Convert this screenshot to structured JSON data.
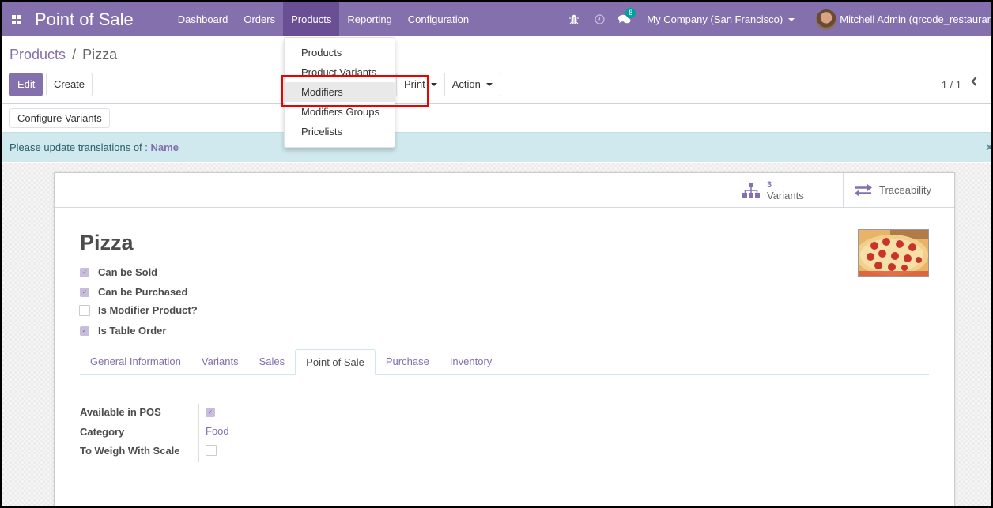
{
  "navbar": {
    "app_title": "Point of Sale",
    "menu": [
      {
        "label": "Dashboard",
        "active": false
      },
      {
        "label": "Orders",
        "active": false
      },
      {
        "label": "Products",
        "active": true
      },
      {
        "label": "Reporting",
        "active": false
      },
      {
        "label": "Configuration",
        "active": false
      }
    ],
    "systray": {
      "debug_icon": "bug-icon",
      "activity_icon": "clock-icon",
      "messages_icon": "chat-icon",
      "messages_count": "8",
      "company": "My Company (San Francisco)",
      "user": "Mitchell Admin (qrcode_restaurar"
    },
    "color": "#8470ad",
    "active_color": "#6b4f95"
  },
  "products_menu": {
    "items": [
      {
        "label": "Products"
      },
      {
        "label": "Product Variants"
      },
      {
        "label": "Modifiers",
        "hovered": true
      },
      {
        "label": "Modifiers Groups"
      },
      {
        "label": "Pricelists"
      }
    ]
  },
  "control_panel": {
    "breadcrumb": {
      "parent": "Products",
      "separator": "/",
      "current": "Pizza"
    },
    "edit_label": "Edit",
    "create_label": "Create",
    "print_label": "Print",
    "action_label": "Action",
    "pager": "1 / 1"
  },
  "statusbar": {
    "configure_variants_label": "Configure Variants"
  },
  "alert": {
    "text": "Please update translations of :",
    "field": "Name"
  },
  "form": {
    "stat_buttons": {
      "variants_value": "3",
      "variants_label": "Variants",
      "traceability_label": "Traceability"
    },
    "product_name": "Pizza",
    "checkboxes": [
      {
        "label": "Can be Sold",
        "checked": true
      },
      {
        "label": "Can be Purchased",
        "checked": true
      },
      {
        "label": "Is Modifier Product?",
        "checked": false
      },
      {
        "label": "Is Table Order",
        "checked": true
      }
    ],
    "tabs": [
      {
        "label": "General Information",
        "active": false
      },
      {
        "label": "Variants",
        "active": false
      },
      {
        "label": "Sales",
        "active": false
      },
      {
        "label": "Point of Sale",
        "active": true
      },
      {
        "label": "Purchase",
        "active": false
      },
      {
        "label": "Inventory",
        "active": false
      }
    ],
    "pos_fields": {
      "available_in_pos_label": "Available in POS",
      "available_in_pos": true,
      "category_label": "Category",
      "category_value": "Food",
      "to_weigh_label": "To Weigh With Scale",
      "to_weigh": false
    }
  }
}
